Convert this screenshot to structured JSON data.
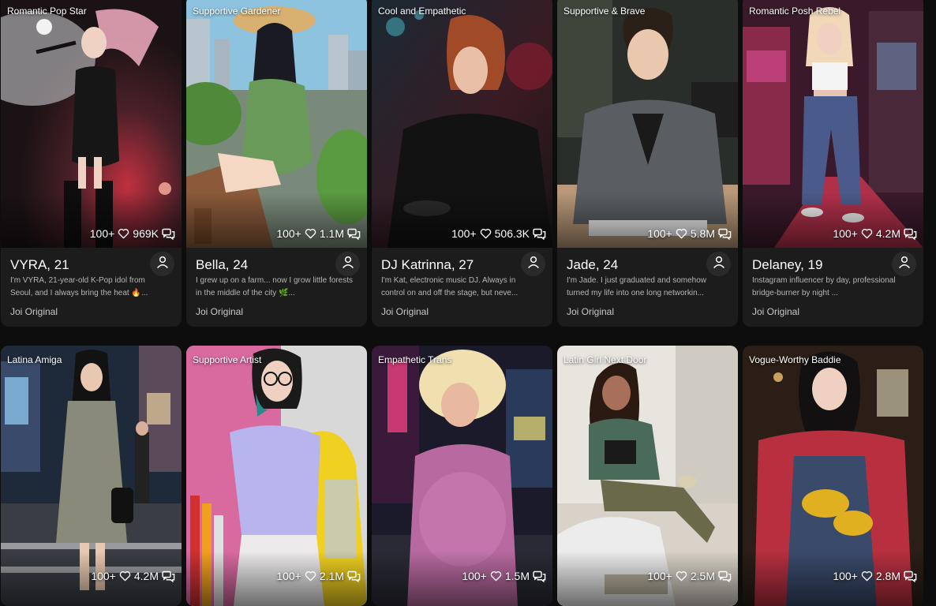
{
  "cards": [
    {
      "tag": "Romantic Pop Star",
      "likes_prefix": "100+",
      "likes": "969K",
      "name": "VYRA, 21",
      "description": "I'm VYRA, 21-year-old K-Pop idol from Seoul, and I always bring the heat 🔥...",
      "brand": "Joi Original"
    },
    {
      "tag": "Supportive Gardener",
      "likes_prefix": "100+",
      "likes": "1.1M",
      "name": "Bella, 24",
      "description": "I grew up on a farm... now I grow little forests in the middle of the city 🌿...",
      "brand": "Joi Original"
    },
    {
      "tag": "Cool and Empathetic",
      "likes_prefix": "100+",
      "likes": "506.3K",
      "name": "DJ Katrinna, 27",
      "description": "I'm Kat, electronic music DJ. Always in control on and off the stage, but neve...",
      "brand": "Joi Original"
    },
    {
      "tag": "Supportive & Brave",
      "likes_prefix": "100+",
      "likes": "5.8M",
      "name": "Jade, 24",
      "description": "I'm Jade. I just graduated and somehow turned my life into one long networkin...",
      "brand": "Joi Original"
    },
    {
      "tag": "Romantic Posh Rebel",
      "likes_prefix": "100+",
      "likes": "4.2M",
      "name": "Delaney, 19",
      "description": "Instagram influencer by day, professional bridge-burner by night ...",
      "brand": "Joi Original"
    },
    {
      "tag": "Latina Amiga",
      "likes_prefix": "100+",
      "likes": "4.2M"
    },
    {
      "tag": "Supportive Artist",
      "likes_prefix": "100+",
      "likes": "2.1M"
    },
    {
      "tag": "Empathetic Trans",
      "likes_prefix": "100+",
      "likes": "1.5M"
    },
    {
      "tag": "Latin Girl Next Door",
      "likes_prefix": "100+",
      "likes": "2.5M"
    },
    {
      "tag": "Vogue-Worthy Baddie",
      "likes_prefix": "100+",
      "likes": "2.8M"
    }
  ],
  "icons": {
    "like": "heart-icon",
    "chat": "chat-icon",
    "profile": "user-icon"
  },
  "colors": {
    "background": "#0d0d0d",
    "card": "#1c1c1c",
    "text": "#ffffff",
    "muted_text": "#b5b5b5"
  }
}
